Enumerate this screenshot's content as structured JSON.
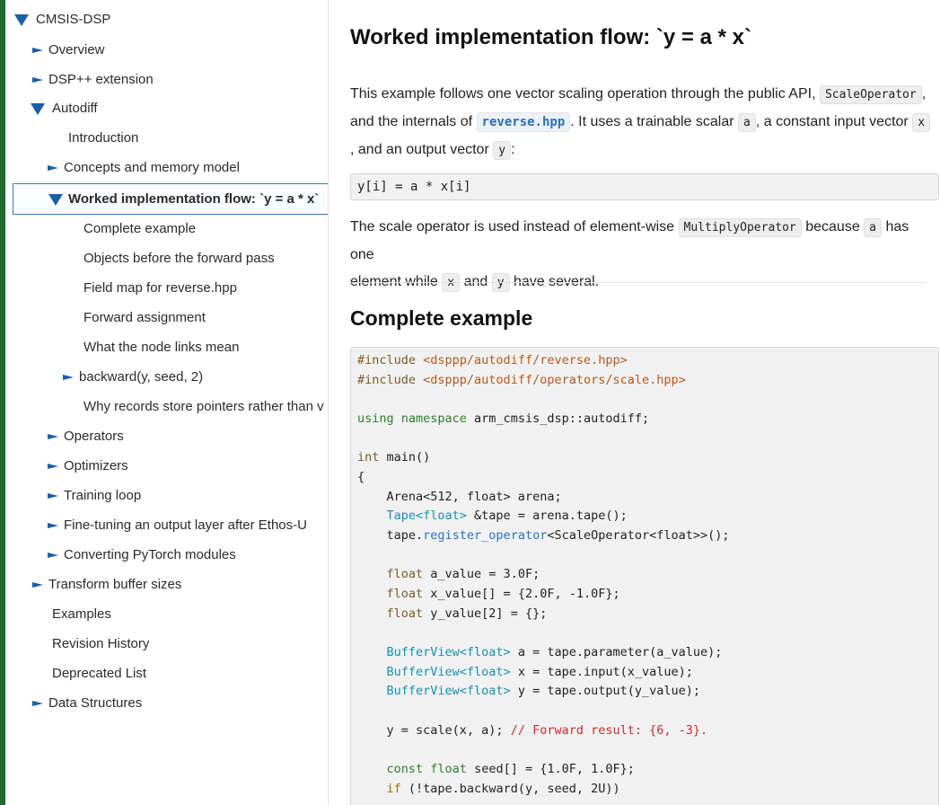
{
  "colors": {
    "accent_bar": "#1e6a2f",
    "link": "#1a5fa8",
    "selected_border": "#3c7ac0"
  },
  "sidebar": {
    "items": [
      {
        "label": "CMSIS-DSP",
        "state": "expanded",
        "indent": 0
      },
      {
        "label": "Overview",
        "state": "collapsed",
        "indent": 1
      },
      {
        "label": "DSP++ extension",
        "state": "collapsed",
        "indent": 1
      },
      {
        "label": "Autodiff",
        "state": "expanded",
        "indent": 1
      },
      {
        "label": "Introduction",
        "state": "leaf",
        "indent": 2
      },
      {
        "label": "Concepts and memory model",
        "state": "collapsed",
        "indent": 2
      },
      {
        "label": "Worked implementation flow: `y = a * x`",
        "state": "expanded",
        "indent": 2,
        "selected": true
      },
      {
        "label": "Complete example",
        "state": "leaf",
        "indent": 3
      },
      {
        "label": "Objects before the forward pass",
        "state": "leaf",
        "indent": 3
      },
      {
        "label": "Field map for reverse.hpp",
        "state": "leaf",
        "indent": 3
      },
      {
        "label": "Forward assignment",
        "state": "leaf",
        "indent": 3
      },
      {
        "label": "What the node links mean",
        "state": "leaf",
        "indent": 3
      },
      {
        "label": "backward(y, seed, 2)",
        "state": "collapsed",
        "indent": 3
      },
      {
        "label": "Why records store pointers rather than v",
        "state": "leaf",
        "indent": 3
      },
      {
        "label": "Operators",
        "state": "collapsed",
        "indent": 2
      },
      {
        "label": "Optimizers",
        "state": "collapsed",
        "indent": 2
      },
      {
        "label": "Training loop",
        "state": "collapsed",
        "indent": 2
      },
      {
        "label": "Fine-tuning an output layer after Ethos-U",
        "state": "collapsed",
        "indent": 2
      },
      {
        "label": "Converting PyTorch modules",
        "state": "collapsed",
        "indent": 2
      },
      {
        "label": "Transform buffer sizes",
        "state": "collapsed",
        "indent": 1
      },
      {
        "label": "Examples",
        "state": "leaf",
        "indent": 1
      },
      {
        "label": "Revision History",
        "state": "leaf",
        "indent": 1
      },
      {
        "label": "Deprecated List",
        "state": "leaf",
        "indent": 1
      },
      {
        "label": "Data Structures",
        "state": "collapsed",
        "indent": 1
      }
    ]
  },
  "main": {
    "title": "Worked implementation flow: `y = a * x`",
    "intro": {
      "t1": "This example follows one vector scaling operation through the public API,",
      "c1": "ScaleOperator",
      "t2": ",",
      "t3": "and the internals of",
      "link": "reverse.hpp",
      "t4": ". It uses a trainable scalar",
      "c2": "a",
      "t5": ", a constant input vector",
      "c3": "x",
      "t6": ", and an output vector",
      "c4": "y",
      "t7": ":"
    },
    "formula": "y[i] = a * x[i]",
    "para2": {
      "t1": "The scale operator is used instead of element-wise",
      "c1": "MultiplyOperator",
      "t2": "because",
      "c2": "a",
      "t3": "has one",
      "t4": "element while",
      "c3": "x",
      "t5": "and",
      "c4": "y",
      "t6": "have several."
    },
    "section_title": "Complete example",
    "code": {
      "l1a": "#include ",
      "l1b": "<dsppp/autodiff/reverse.hpp>",
      "l2a": "#include ",
      "l2b": "<dsppp/autodiff/operators/scale.hpp>",
      "l3a": "using",
      "l3b": " namespace",
      "l3c": " arm_cmsis_dsp::autodiff;",
      "l4a": "int",
      "l4b": " main()",
      "l5": "{",
      "l6": "    Arena<512, float> arena;",
      "l7a": "    ",
      "l7b": "Tape<float>",
      "l7c": " &tape = arena.tape();",
      "l8a": "    tape.",
      "l8b": "register_operator",
      "l8c": "<ScaleOperator<float>>();",
      "l9a": "    ",
      "l9b": "float",
      "l9c": " a_value = 3.0F;",
      "l10a": "    ",
      "l10b": "float",
      "l10c": " x_value[] = {2.0F, -1.0F};",
      "l11a": "    ",
      "l11b": "float",
      "l11c": " y_value[2] = {};",
      "l12a": "    ",
      "l12b": "BufferView<float>",
      "l12c": " a = tape.parameter(a_value);",
      "l13a": "    ",
      "l13b": "BufferView<float>",
      "l13c": " x = tape.input(x_value);",
      "l14a": "    ",
      "l14b": "BufferView<float>",
      "l14c": " y = tape.output(y_value);",
      "l15a": "    y = scale(x, a); ",
      "l15b": "// Forward result: {6, -3}.",
      "l16a": "    ",
      "l16b": "const",
      "l16c": " float",
      "l16d": " seed[] = {1.0F, 1.0F};",
      "l17a": "    ",
      "l17b": "if",
      "l17c": " (!tape.backward(y, seed, 2U))"
    }
  }
}
